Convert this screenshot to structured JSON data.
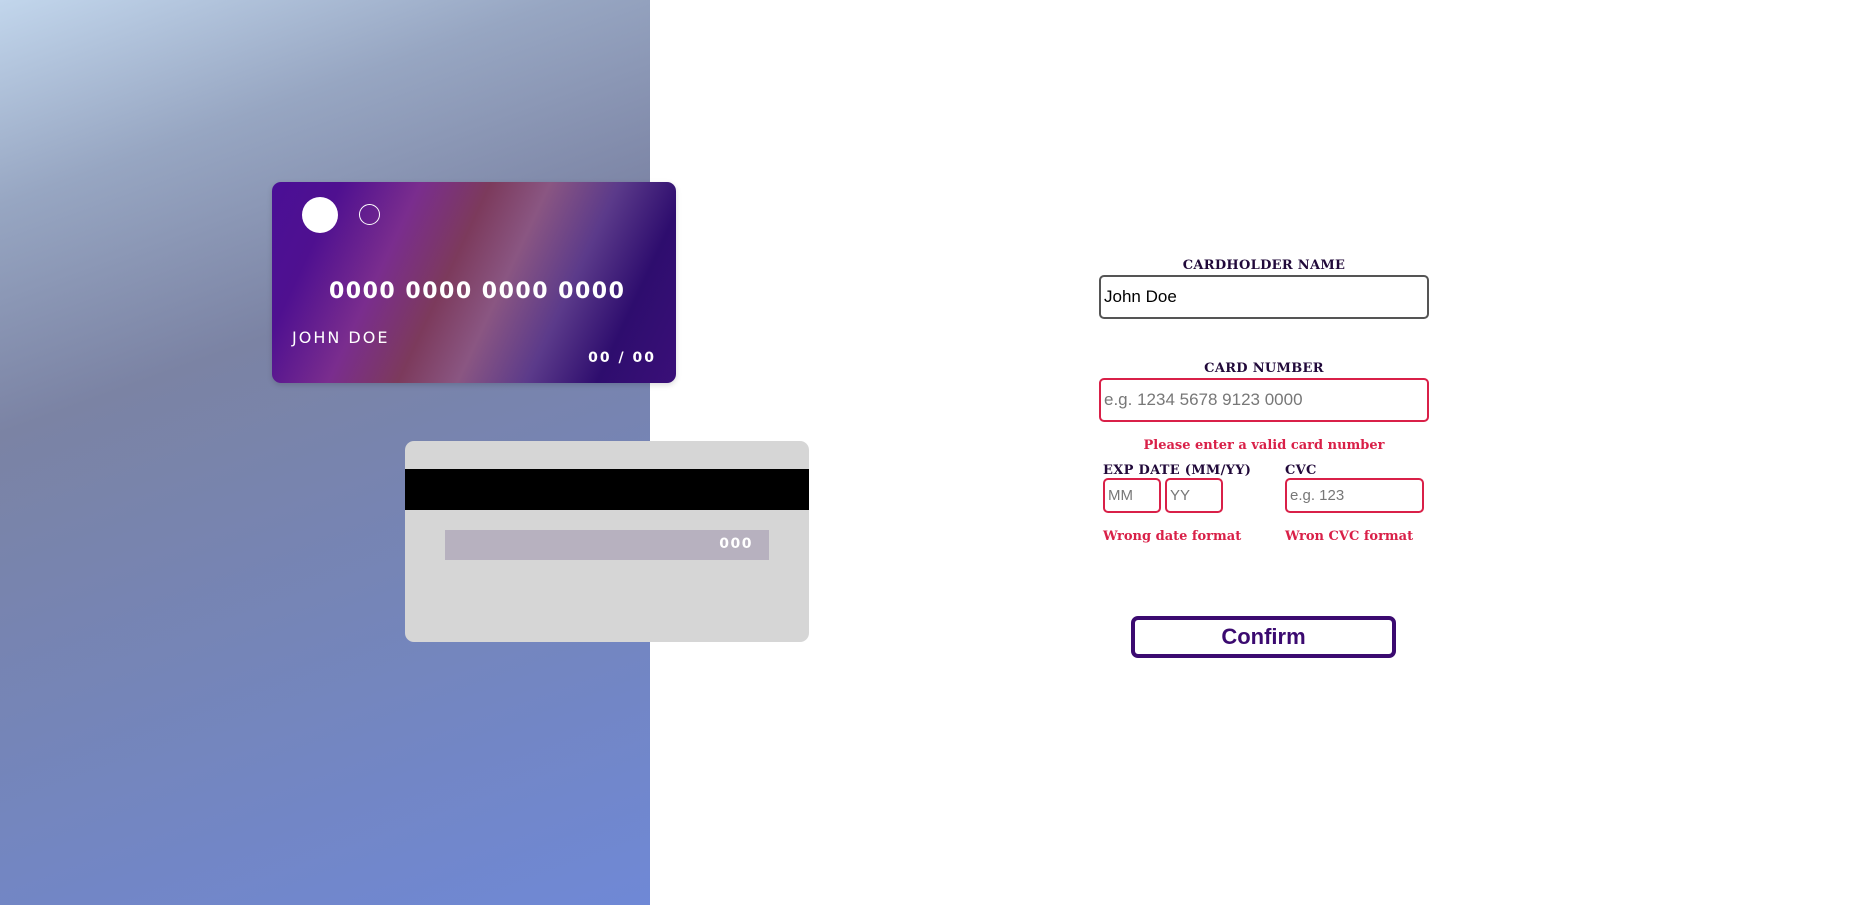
{
  "card_front": {
    "number": "0000 0000 0000 0000",
    "name": "JOHN DOE",
    "exp": "00 / 00"
  },
  "card_back": {
    "cvc": "000"
  },
  "form": {
    "name_label": "CARDHOLDER NAME",
    "name_value": "John Doe",
    "number_label": "CARD NUMBER",
    "number_placeholder": "e.g. 1234 5678 9123 0000",
    "number_error": "Please enter a valid card number",
    "exp_label": "EXP DATE (MM/YY)",
    "mm_placeholder": "MM",
    "yy_placeholder": "YY",
    "date_error": "Wrong date format",
    "cvc_label": "CVC",
    "cvc_placeholder": "e.g. 123",
    "cvc_error": "Wron CVC format",
    "confirm_label": "Confirm"
  },
  "colors": {
    "accent": "#3b0a70",
    "error": "#d92048",
    "label": "#21093a"
  }
}
